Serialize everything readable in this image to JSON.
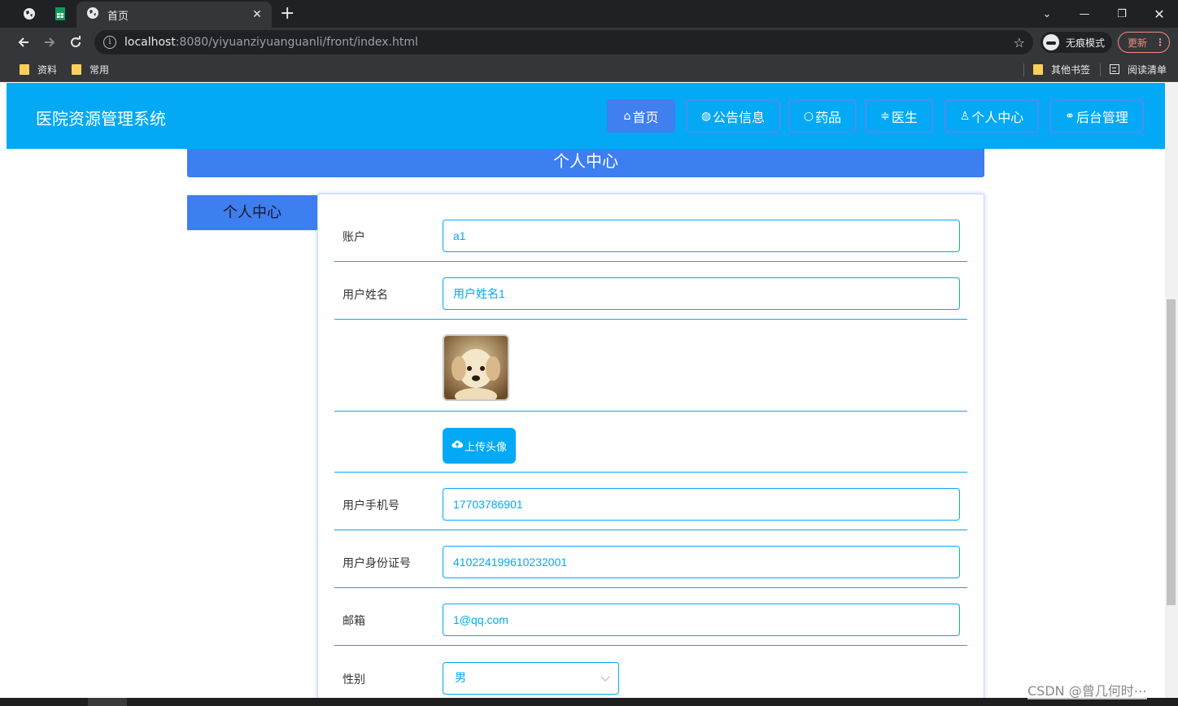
{
  "browser": {
    "tab_title": "首页",
    "url_host": "localhost",
    "url_rest": ":8080/yiyuanziyuanguanli/front/index.html",
    "incognito_label": "无痕模式",
    "update_label": "更新",
    "bookmarks": [
      "资料",
      "常用"
    ],
    "other_bookmarks": "其他书签",
    "reading_list": "阅读清单"
  },
  "site": {
    "title": "医院资源管理系统",
    "nav": [
      {
        "label": "首页",
        "icon": "home-icon",
        "glyph": "⌂"
      },
      {
        "label": "公告信息",
        "icon": "globe-icon",
        "glyph": "◍"
      },
      {
        "label": "药品",
        "icon": "circle-icon",
        "glyph": "○"
      },
      {
        "label": "医生",
        "icon": "sliders-icon",
        "glyph": "≑"
      },
      {
        "label": "个人中心",
        "icon": "user-icon",
        "glyph": "♙"
      },
      {
        "label": "后台管理",
        "icon": "link-icon",
        "glyph": "⚭"
      }
    ]
  },
  "profile": {
    "header": "个人中心",
    "side_tab": "个人中心",
    "fields": {
      "account_label": "账户",
      "account_value": "a1",
      "name_label": "用户姓名",
      "name_value": "用户姓名1",
      "upload_label": "上传头像",
      "phone_label": "用户手机号",
      "phone_value": "17703786901",
      "idcard_label": "用户身份证号",
      "idcard_value": "410224199610232001",
      "email_label": "邮箱",
      "email_value": "1@qq.com",
      "gender_label": "性别",
      "gender_value": "男"
    }
  },
  "watermark": "CSDN @曾几何时⋯",
  "colors": {
    "navbar": "#03a9f4",
    "accent": "#3d7ef0",
    "field_border": "#03a9f4"
  }
}
